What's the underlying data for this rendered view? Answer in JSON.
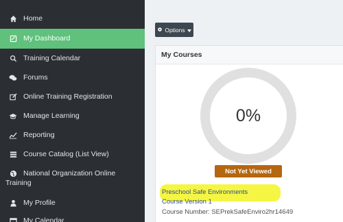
{
  "sidebar": {
    "items": [
      {
        "label": "Home",
        "icon": "home-icon"
      },
      {
        "label": "My Dashboard",
        "icon": "dashboard-icon",
        "active": true
      },
      {
        "label": "Training Calendar",
        "icon": "search-icon"
      },
      {
        "label": "Forums",
        "icon": "forums-icon"
      },
      {
        "label": "Online Training Registration",
        "icon": "edit-icon"
      },
      {
        "label": "Manage Learning",
        "icon": "graduation-cap-icon"
      },
      {
        "label": "Reporting",
        "icon": "chart-line-icon"
      },
      {
        "label": "Course Catalog (List View)",
        "icon": "list-icon"
      },
      {
        "label_line1": "National Organization Online",
        "label_line2": "Training",
        "icon": "globe-icon"
      },
      {
        "label": "My Profile",
        "icon": "user-icon"
      },
      {
        "label": "My Calendar",
        "icon": "calendar-icon"
      }
    ]
  },
  "toolbar": {
    "options_label": "Options"
  },
  "courses": {
    "title": "My Courses",
    "progress_text": "0%",
    "progress_fraction": 0,
    "status": "Not Yet Viewed",
    "course_name": "Preschool Safe Environments",
    "course_version": "Course Version 1",
    "course_number": "Course Number: SEPrekSafeEnviro2hr14649"
  },
  "colors": {
    "sidebar_bg": "#2b2f33",
    "active_item": "#5fc17c",
    "status_badge": "#b5660f",
    "highlight": "#f4f53a"
  }
}
